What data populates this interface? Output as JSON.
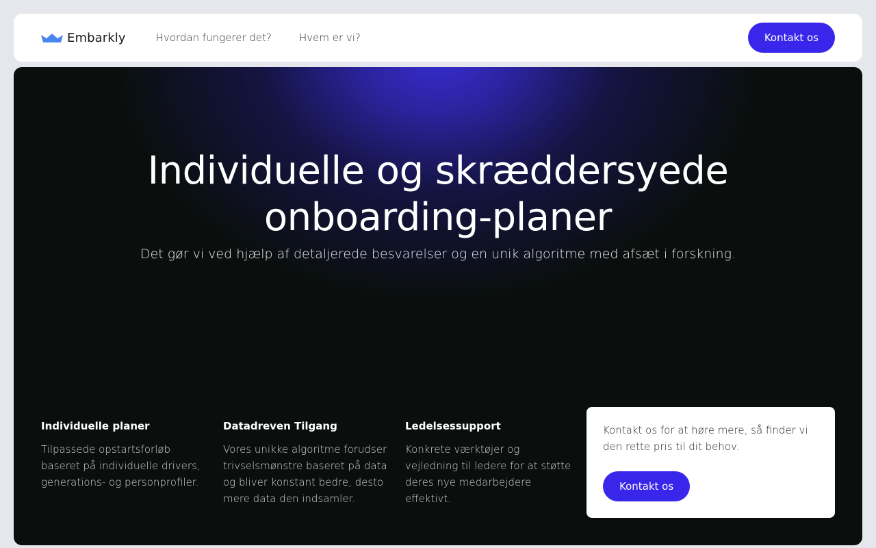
{
  "nav": {
    "brand": "Embarkly",
    "brand_icon": "crown-icon",
    "links": [
      "Hvordan fungerer det?",
      "Hvem er vi?"
    ],
    "cta_label": "Kontakt os"
  },
  "hero": {
    "title": "Individuelle og skræddersyede onboarding-planer",
    "subtitle": "Det gør vi ved hjælp af detaljerede besvarelser og en unik algoritme med afsæt i forskning."
  },
  "features": [
    {
      "title": "Individuelle planer",
      "text": "Tilpassede opstartsforløb baseret på individuelle drivers, generations-  og personprofiler."
    },
    {
      "title": "Datadreven Tilgang",
      "text": "Vores unikke algoritme forudser trivselsmønstre baseret på data og bliver konstant bedre, desto mere data den  indsamler."
    },
    {
      "title": "Ledelsessupport",
      "text": "Konkrete værktøjer og vejledning til ledere for at støtte deres nye medarbejdere effektivt."
    }
  ],
  "contact": {
    "text": "Kontakt os for at høre mere, så finder vi den rette pris til dit behov.",
    "button_label": "Kontakt os"
  },
  "colors": {
    "accent": "#3826eb",
    "hero_background": "#0a0f0d",
    "page_background": "#e5e7ec",
    "brand_icon": "#4a86f0"
  }
}
